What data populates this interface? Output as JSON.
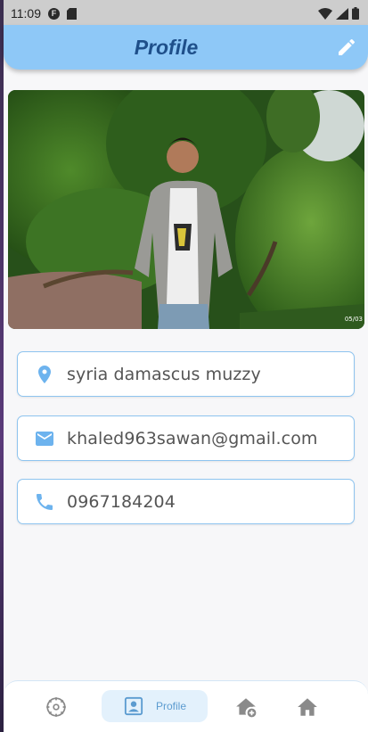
{
  "status_bar": {
    "time": "11:09",
    "icons": [
      "notification-f-icon",
      "sd-card-icon",
      "wifi-icon",
      "signal-icon",
      "battery-icon"
    ]
  },
  "app_bar": {
    "title": "Profile",
    "action_icon": "edit-pencil-icon"
  },
  "profile_photo": {
    "description_icon": "profile-photo",
    "stamp_text": "05/03"
  },
  "fields": [
    {
      "icon": "location-pin-icon",
      "value": "syria damascus muzzy"
    },
    {
      "icon": "email-icon",
      "value": "khaled963sawan@gmail.com"
    },
    {
      "icon": "phone-icon",
      "value": "0967184204"
    }
  ],
  "bottom_nav": {
    "items": [
      {
        "icon": "settings-icon",
        "label": ""
      },
      {
        "icon": "profile-icon",
        "label": "Profile",
        "active": true
      },
      {
        "icon": "add-home-icon",
        "label": ""
      },
      {
        "icon": "home-icon",
        "label": ""
      }
    ]
  },
  "colors": {
    "accent": "#8ec8f7",
    "title": "#1e4f8a",
    "icon": "#6db3ee",
    "nav_active_bg": "#e3f1fc"
  }
}
